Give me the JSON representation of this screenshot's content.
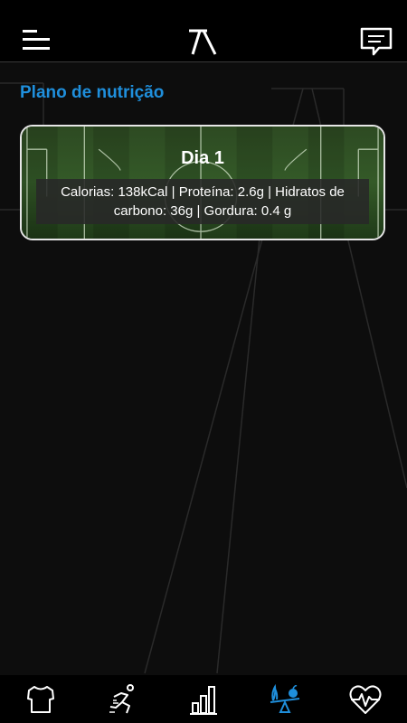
{
  "header": {
    "menu_icon": "hamburger-icon",
    "logo_icon": "ta-logo",
    "chat_icon": "chat-message-icon"
  },
  "page": {
    "title": "Plano de nutrição"
  },
  "day_card": {
    "title": "Dia 1",
    "macros": "Calorias: 138kCal | Proteína: 2.6g | Hidratos de carbono: 36g | Gordura: 0.4 g",
    "background": "football-pitch"
  },
  "bottom_nav": {
    "items": [
      {
        "icon": "jersey-icon",
        "active": false
      },
      {
        "icon": "running-exercise-icon",
        "active": false
      },
      {
        "icon": "bar-chart-icon",
        "active": false
      },
      {
        "icon": "nutrition-balance-icon",
        "active": true
      },
      {
        "icon": "heart-pulse-icon",
        "active": false
      }
    ],
    "active_color": "#1f8fdc",
    "inactive_color": "#ffffff"
  },
  "colors": {
    "accent": "#1f8fdc",
    "background": "#0d0d0d",
    "bar": "#000000"
  }
}
